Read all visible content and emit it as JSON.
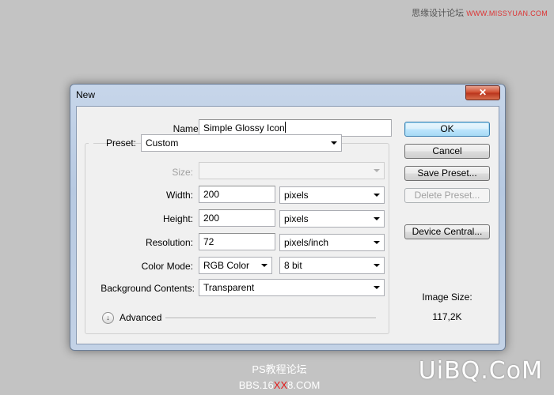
{
  "watermarks": {
    "top_cn": "思缘设计论坛",
    "top_en": "WWW.MISSYUAN.COM",
    "bottom_cn": "PS教程论坛",
    "bottom_pre": "BBS.16",
    "bottom_red": "XX",
    "bottom_post": "8.COM",
    "logo": "UiBQ.CoM"
  },
  "dialog": {
    "title": "New",
    "close_glyph": "✕",
    "name_label": "Name:",
    "name_value": "Simple Glossy Icon",
    "preset_label": "Preset:",
    "preset_value": "Custom",
    "size_label": "Size:",
    "size_value": "",
    "width_label": "Width:",
    "width_value": "200",
    "width_unit": "pixels",
    "height_label": "Height:",
    "height_value": "200",
    "height_unit": "pixels",
    "resolution_label": "Resolution:",
    "resolution_value": "72",
    "resolution_unit": "pixels/inch",
    "color_mode_label": "Color Mode:",
    "color_mode_value": "RGB Color",
    "bit_depth_value": "8 bit",
    "background_label": "Background Contents:",
    "background_value": "Transparent",
    "advanced_label": "Advanced",
    "advanced_icon": "chevron-double-down-icon",
    "buttons": {
      "ok": "OK",
      "cancel": "Cancel",
      "save_preset": "Save Preset...",
      "delete_preset": "Delete Preset...",
      "device_central": "Device Central..."
    },
    "image_size_label": "Image Size:",
    "image_size_value": "117,2K"
  }
}
